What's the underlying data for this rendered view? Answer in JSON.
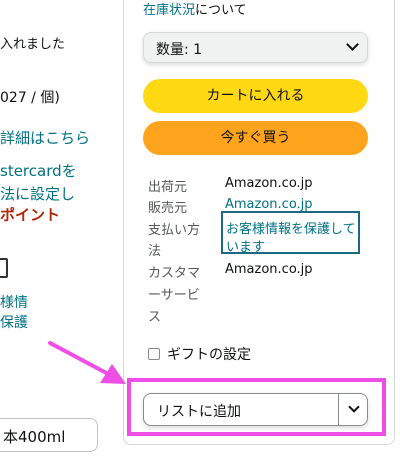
{
  "left_panel": {
    "line1": "入れました",
    "price_unit": "027 / 個)",
    "details_link": "詳細はこちら",
    "card_line1": "stercardを",
    "card_line2": "法に設定し",
    "points": "ポイント",
    "icon_label1": "様情",
    "icon_label2": "保護",
    "size_option": "本400ml"
  },
  "buybox": {
    "stock_link": "在庫状況",
    "stock_suffix": "について",
    "quantity_label": "数量: 1",
    "add_to_cart": "カートに入れる",
    "buy_now": "今すぐ買う",
    "shipper_label": "出荷元",
    "shipper_value": "Amazon.co.jp",
    "seller_label": "販売元",
    "seller_value": "Amazon.co.jp",
    "payment_label_1": "支払い方",
    "payment_label_2": "法",
    "payment_value_1": "お客様情報を保護して",
    "payment_value_2": "います",
    "support_label_1": "カスタマ",
    "support_label_2": "ーサービ",
    "support_label_3": "ス",
    "support_value": "Amazon.co.jp",
    "gift_label": "ギフトの設定",
    "add_to_list": "リストに追加"
  },
  "colors": {
    "accent_link": "#007185",
    "cart_button": "#ffd814",
    "buy_button": "#ffa41c",
    "highlight": "#ee4ee6",
    "points_red": "#b12704"
  }
}
